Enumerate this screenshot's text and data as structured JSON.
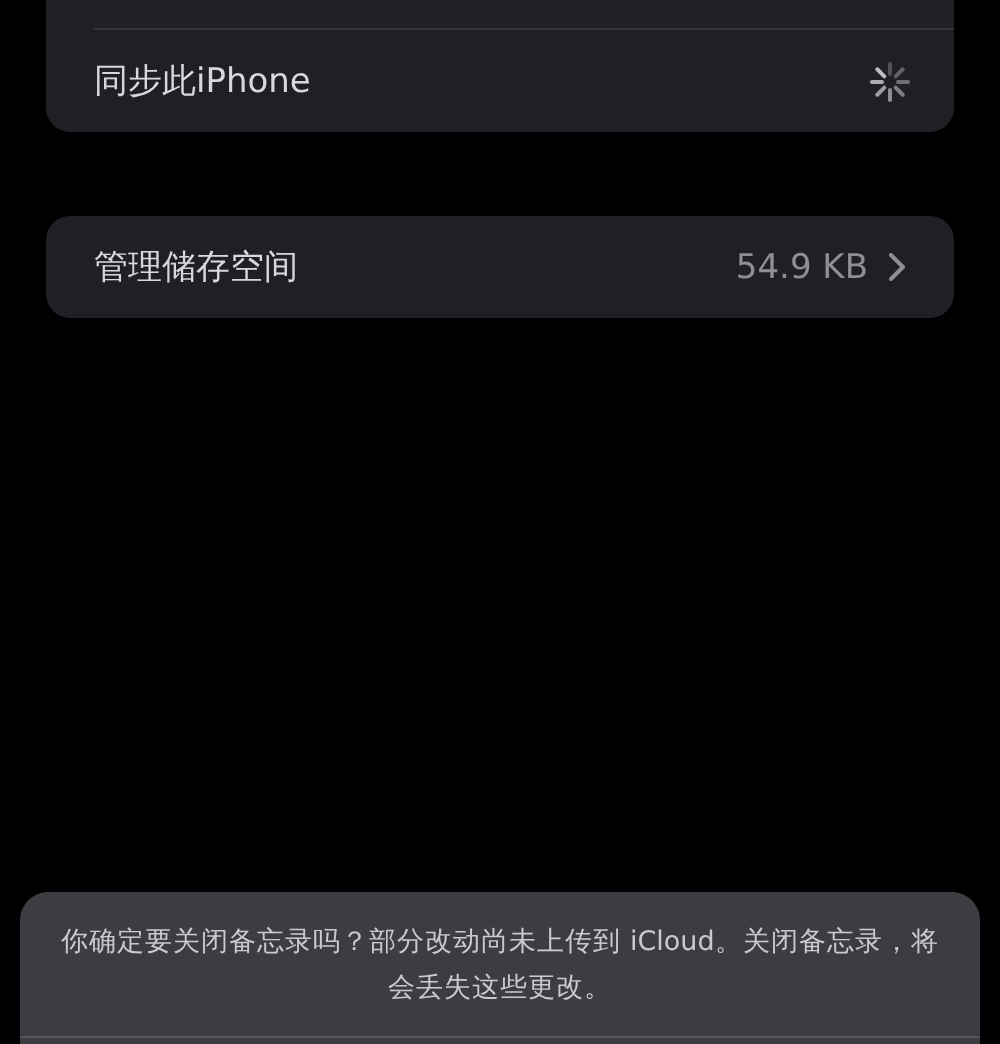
{
  "sync_card": {
    "label": "同步此iPhone"
  },
  "storage_card": {
    "label": "管理储存空间",
    "value": "54.9 KB"
  },
  "action_sheet": {
    "message": "你确定要关闭备忘录吗？部分改动尚未上传到 iCloud。关闭备忘录，将会丢失这些更改。"
  }
}
